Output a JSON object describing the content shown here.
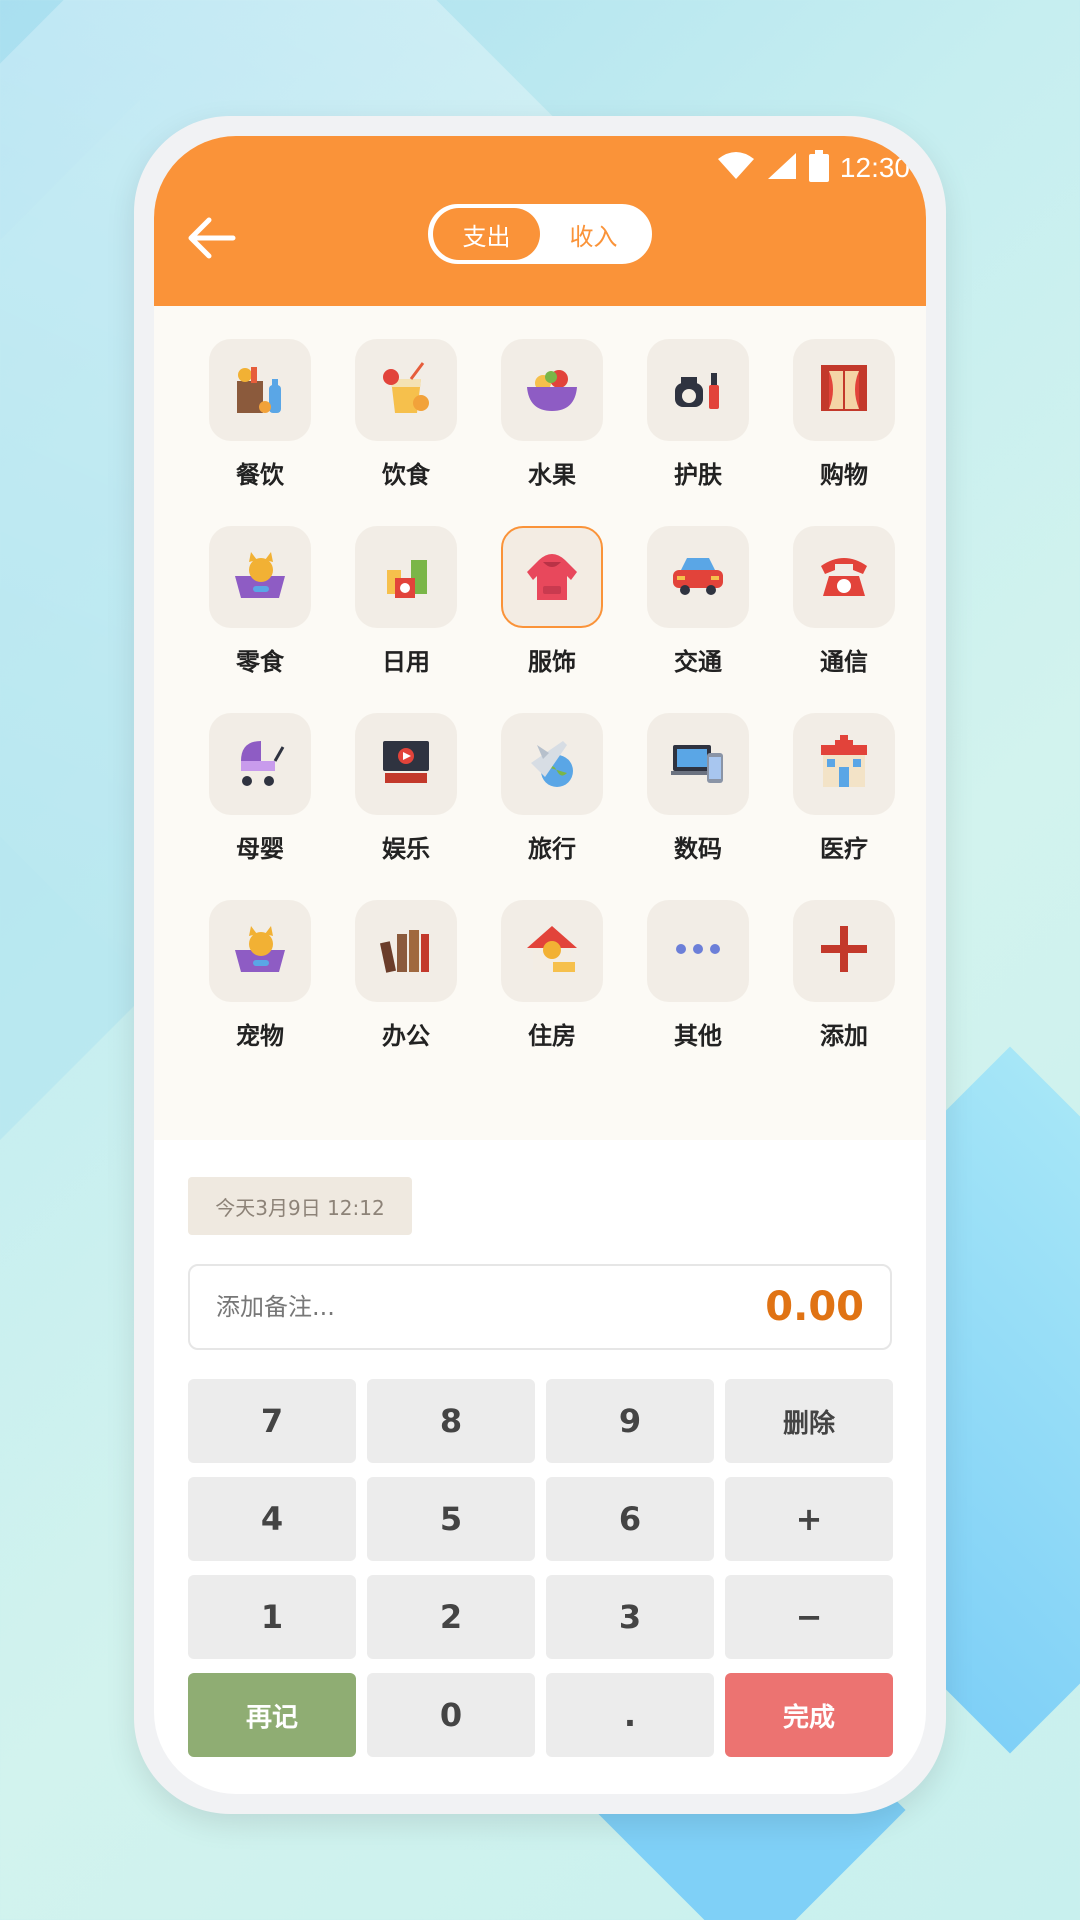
{
  "status": {
    "time": "12:30"
  },
  "header": {
    "tabs": [
      {
        "label": "支出",
        "active": true
      },
      {
        "label": "收入",
        "active": false
      }
    ]
  },
  "colors": {
    "accent": "#fa9339",
    "amount": "#e07314",
    "again": "#8fad73",
    "done": "#ec7371"
  },
  "categories": [
    {
      "label": "餐饮",
      "icon": "grocery-bag-icon",
      "selected": false
    },
    {
      "label": "饮食",
      "icon": "juice-drink-icon",
      "selected": false
    },
    {
      "label": "水果",
      "icon": "fruit-bowl-icon",
      "selected": false
    },
    {
      "label": "护肤",
      "icon": "skincare-bottles-icon",
      "selected": false
    },
    {
      "label": "购物",
      "icon": "shop-window-icon",
      "selected": false
    },
    {
      "label": "零食",
      "icon": "cat-basket-icon",
      "selected": false
    },
    {
      "label": "日用",
      "icon": "daily-goods-icon",
      "selected": false
    },
    {
      "label": "服饰",
      "icon": "hoodie-icon",
      "selected": true
    },
    {
      "label": "交通",
      "icon": "car-icon",
      "selected": false
    },
    {
      "label": "通信",
      "icon": "telephone-icon",
      "selected": false
    },
    {
      "label": "母婴",
      "icon": "baby-stroller-icon",
      "selected": false
    },
    {
      "label": "娱乐",
      "icon": "tv-play-icon",
      "selected": false
    },
    {
      "label": "旅行",
      "icon": "airplane-globe-icon",
      "selected": false
    },
    {
      "label": "数码",
      "icon": "laptop-phone-icon",
      "selected": false
    },
    {
      "label": "医疗",
      "icon": "hospital-icon",
      "selected": false
    },
    {
      "label": "宠物",
      "icon": "cat-basket-icon",
      "selected": false
    },
    {
      "label": "办公",
      "icon": "books-icon",
      "selected": false
    },
    {
      "label": "住房",
      "icon": "house-coin-icon",
      "selected": false
    },
    {
      "label": "其他",
      "icon": "more-dots-icon",
      "selected": false
    },
    {
      "label": "添加",
      "icon": "plus-icon",
      "selected": false
    }
  ],
  "entry": {
    "date": "今天3月9日 12:12",
    "note_placeholder": "添加备注...",
    "note_value": "",
    "amount": "0.00"
  },
  "keypad": [
    {
      "label": "7",
      "name": "key-7"
    },
    {
      "label": "8",
      "name": "key-8"
    },
    {
      "label": "9",
      "name": "key-9"
    },
    {
      "label": "删除",
      "name": "delete-button"
    },
    {
      "label": "4",
      "name": "key-4"
    },
    {
      "label": "5",
      "name": "key-5"
    },
    {
      "label": "6",
      "name": "key-6"
    },
    {
      "label": "+",
      "name": "plus-key"
    },
    {
      "label": "1",
      "name": "key-1"
    },
    {
      "label": "2",
      "name": "key-2"
    },
    {
      "label": "3",
      "name": "key-3"
    },
    {
      "label": "−",
      "name": "minus-key"
    },
    {
      "label": "再记",
      "name": "record-again-button"
    },
    {
      "label": "0",
      "name": "key-0"
    },
    {
      "label": ".",
      "name": "decimal-key"
    },
    {
      "label": "完成",
      "name": "done-button"
    }
  ]
}
